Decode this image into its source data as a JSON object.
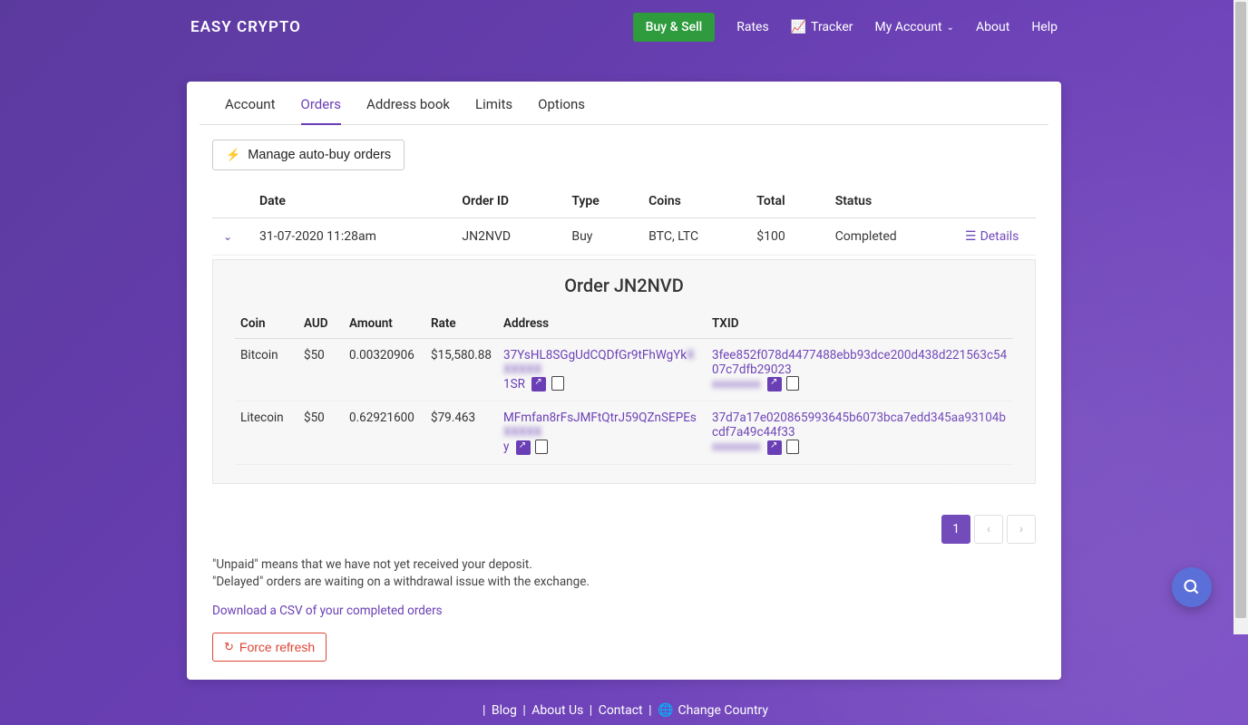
{
  "brand": "EASY CRYPTO",
  "nav": {
    "buysell": "Buy & Sell",
    "rates": "Rates",
    "tracker": "Tracker",
    "myaccount": "My Account",
    "about": "About",
    "help": "Help"
  },
  "tabs": {
    "account": "Account",
    "orders": "Orders",
    "addressbook": "Address book",
    "limits": "Limits",
    "options": "Options"
  },
  "manage": "Manage auto-buy orders",
  "th": {
    "date": "Date",
    "orderid": "Order ID",
    "type": "Type",
    "coins": "Coins",
    "total": "Total",
    "status": "Status"
  },
  "row": {
    "date": "31-07-2020 11:28am",
    "orderid": "JN2NVD",
    "type": "Buy",
    "coins": "BTC, LTC",
    "total": "$100",
    "status": "Completed",
    "details": "Details"
  },
  "expanded": {
    "title": "Order JN2NVD",
    "th": {
      "coin": "Coin",
      "aud": "AUD",
      "amount": "Amount",
      "rate": "Rate",
      "address": "Address",
      "txid": "TXID"
    },
    "rows": [
      {
        "coin": "Bitcoin",
        "aud": "$50",
        "amount": "0.00320906",
        "rate": "$15,580.88",
        "addr1": "37YsHL8SGgUdCQDfGr9tFhWgYk",
        "addr_blur": "XXXXXX",
        "addr2": "1SR",
        "txid1": "3fee852f078d4477488ebb93dce200d438d221563c5407c7dfb29023",
        "txid_blur": "xxxxxxxx"
      },
      {
        "coin": "Litecoin",
        "aud": "$50",
        "amount": "0.62921600",
        "rate": "$79.463",
        "addr1": "MFmfan8rFsJMFtQtrJ59QZnSEPEs",
        "addr_blur": "XXXXX",
        "addr2": "y",
        "txid1": "37d7a17e020865993645b6073bca7edd345aa93104bcdf7a49c44f33",
        "txid_blur": "xxxxxxxx"
      }
    ]
  },
  "page1": "1",
  "notes": {
    "l1": "\"Unpaid\" means that we have not yet received your deposit.",
    "l2": "\"Delayed\" orders are waiting on a withdrawal issue with the exchange."
  },
  "csv": "Download a CSV of your completed orders",
  "refresh": "Force refresh",
  "footer": {
    "blog": "Blog",
    "aboutus": "About Us",
    "contact": "Contact",
    "change": "Change Country"
  }
}
